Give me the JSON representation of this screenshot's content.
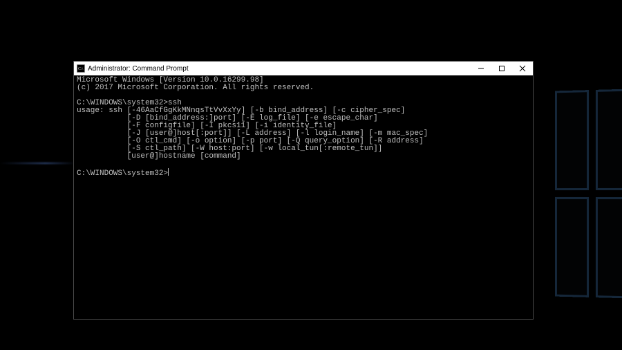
{
  "window": {
    "title": "Administrator: Command Prompt",
    "icon_name": "cmd-icon"
  },
  "terminal": {
    "lines": [
      "Microsoft Windows [Version 10.0.16299.98]",
      "(c) 2017 Microsoft Corporation. All rights reserved.",
      "",
      "C:\\WINDOWS\\system32>ssh",
      "usage: ssh [-46AaCfGgKkMNnqsTtVvXxYy] [-b bind_address] [-c cipher_spec]",
      "           [-D [bind_address:]port] [-E log_file] [-e escape_char]",
      "           [-F configfile] [-I pkcs11] [-i identity_file]",
      "           [-J [user@]host[:port]] [-L address] [-l login_name] [-m mac_spec]",
      "           [-O ctl_cmd] [-o option] [-p port] [-Q query_option] [-R address]",
      "           [-S ctl_path] [-W host:port] [-w local_tun[:remote_tun]]",
      "           [user@]hostname [command]",
      "",
      "C:\\WINDOWS\\system32>"
    ],
    "prompt": "C:\\WINDOWS\\system32>"
  },
  "controls": {
    "minimize_name": "minimize-button",
    "maximize_name": "maximize-button",
    "close_name": "close-button"
  }
}
